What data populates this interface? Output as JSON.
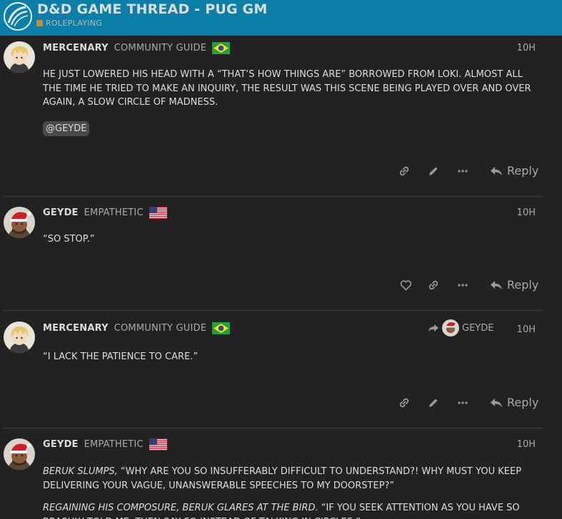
{
  "header": {
    "title": "D&D GAME THREAD - PUG GM",
    "category": "ROLEPLAYING",
    "category_color": "#b3904f",
    "bar_color": "#0b7fa7"
  },
  "posts": [
    {
      "username": "MERCENARY",
      "user_title": "COMMUNITY GUIDE",
      "flag": "brazil-flag",
      "time": "10H",
      "paragraphs": [
        "HE JUST LOWERED HIS HEAD WITH A “THAT’S HOW THINGS ARE” BORROWED FROM LOKI. ALMOST ALL THE TIME HE TRIED TO MAKE AN INQUIRY, THE RESULT WAS THIS SCENE BEING PLAYED OVER AND OVER AGAIN, A SLOW CIRCLE OF MADNESS."
      ],
      "mention": "@GEYDE",
      "reply_label": "Reply"
    },
    {
      "username": "GEYDE",
      "user_title": "EMPATHETIC",
      "flag": "usa-flag",
      "time": "10H",
      "paragraphs": [
        "“SO STOP.”"
      ],
      "reply_label": "Reply"
    },
    {
      "username": "MERCENARY",
      "user_title": "COMMUNITY GUIDE",
      "flag": "brazil-flag",
      "time": "10H",
      "reply_to": "GEYDE",
      "paragraphs": [
        "“I LACK THE PATIENCE TO CARE.”"
      ],
      "reply_label": "Reply"
    },
    {
      "username": "GEYDE",
      "user_title": "EMPATHETIC",
      "flag": "usa-flag",
      "time": "10H",
      "p1_italic": "BERUK SLUMPS,",
      "p1_text": " “WHY ARE YOU SO INSUFFERABLY DIFFICULT TO UNDERSTAND?! WHY MUST YOU KEEP DELIVERING YOUR VAGUE, UNANSWERABLE SPEECHES TO MY DOORSTEP?”",
      "p2_italic": "REGAINING HIS COMPOSURE, BERUK GLARES AT THE BIRD.",
      "p2_text": " “IF YOU SEEK ATTENTION AS YOU HAVE SO BRASHLY TOLD ME, THEN SAY SO INSTEAD OF TALKING IN CIRCLES.”"
    }
  ]
}
